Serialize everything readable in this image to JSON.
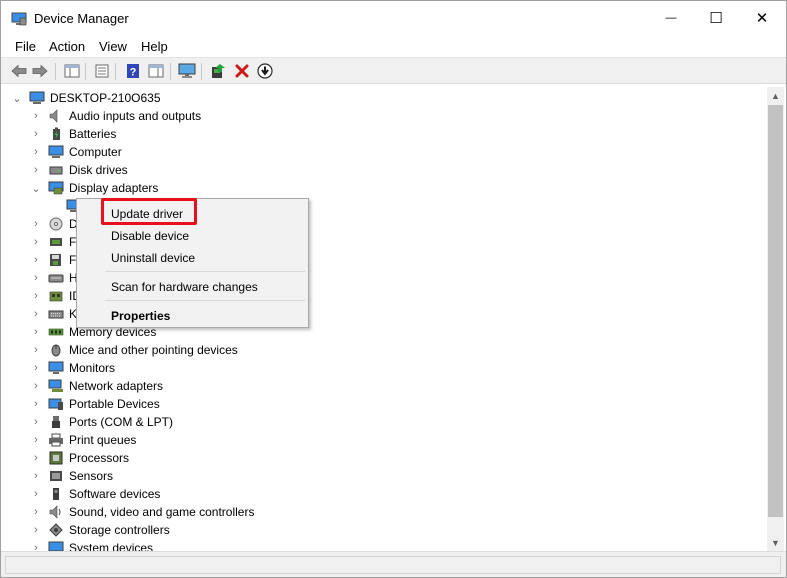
{
  "window": {
    "title": "Device Manager",
    "buttons": {
      "minimize": "—",
      "maximize": "☐",
      "close": "✕"
    }
  },
  "menu": [
    "File",
    "Action",
    "View",
    "Help"
  ],
  "toolbar": {
    "icons": [
      "back-arrow-icon",
      "forward-arrow-icon",
      "show-hide-tree-icon",
      "properties-icon",
      "help-icon",
      "action-pane-icon",
      "monitor-icon",
      "add-driver-icon",
      "uninstall-x-icon",
      "update-download-icon"
    ],
    "colors": {
      "uninstall_x": "#d01818",
      "help": "#2e46b8",
      "add_driver_green": "#19a33a"
    }
  },
  "tree": {
    "root": "DESKTOP-210O635",
    "items": [
      {
        "label": "Audio inputs and outputs",
        "icon": "speaker-icon",
        "expanded": false
      },
      {
        "label": "Batteries",
        "icon": "battery-icon",
        "expanded": false
      },
      {
        "label": "Computer",
        "icon": "computer-icon",
        "expanded": false
      },
      {
        "label": "Disk drives",
        "icon": "disk-drive-icon",
        "expanded": false
      },
      {
        "label": "Display adapters",
        "icon": "display-adapter-icon",
        "expanded": true
      },
      {
        "label": "",
        "icon": "display-adapter-child-icon",
        "expanded": null
      },
      {
        "label": "D",
        "icon": "dvd-drive-icon",
        "expanded": false
      },
      {
        "label": "F",
        "icon": "firmware-icon",
        "expanded": false
      },
      {
        "label": "F",
        "icon": "floppy-icon",
        "expanded": false
      },
      {
        "label": "H",
        "icon": "hid-icon",
        "expanded": false
      },
      {
        "label": "ID",
        "icon": "ide-controller-icon",
        "expanded": false
      },
      {
        "label": "K",
        "icon": "keyboard-icon",
        "expanded": false
      },
      {
        "label": "Memory devices",
        "icon": "memory-icon",
        "expanded": false
      },
      {
        "label": "Mice and other pointing devices",
        "icon": "mouse-icon",
        "expanded": false
      },
      {
        "label": "Monitors",
        "icon": "monitor-device-icon",
        "expanded": false
      },
      {
        "label": "Network adapters",
        "icon": "network-adapter-icon",
        "expanded": false
      },
      {
        "label": "Portable Devices",
        "icon": "portable-device-icon",
        "expanded": false
      },
      {
        "label": "Ports (COM & LPT)",
        "icon": "port-icon",
        "expanded": false
      },
      {
        "label": "Print queues",
        "icon": "printer-icon",
        "expanded": false
      },
      {
        "label": "Processors",
        "icon": "processor-icon",
        "expanded": false
      },
      {
        "label": "Sensors",
        "icon": "sensor-icon",
        "expanded": false
      },
      {
        "label": "Software devices",
        "icon": "software-device-icon",
        "expanded": false
      },
      {
        "label": "Sound, video and game controllers",
        "icon": "sound-icon",
        "expanded": false
      },
      {
        "label": "Storage controllers",
        "icon": "storage-controller-icon",
        "expanded": false
      },
      {
        "label": "System devices",
        "icon": "system-device-icon",
        "expanded": false
      }
    ]
  },
  "context_menu": {
    "items": [
      "Update driver",
      "Disable device",
      "Uninstall device",
      "Scan for hardware changes",
      "Properties"
    ],
    "highlight_color": "#e8101a"
  }
}
